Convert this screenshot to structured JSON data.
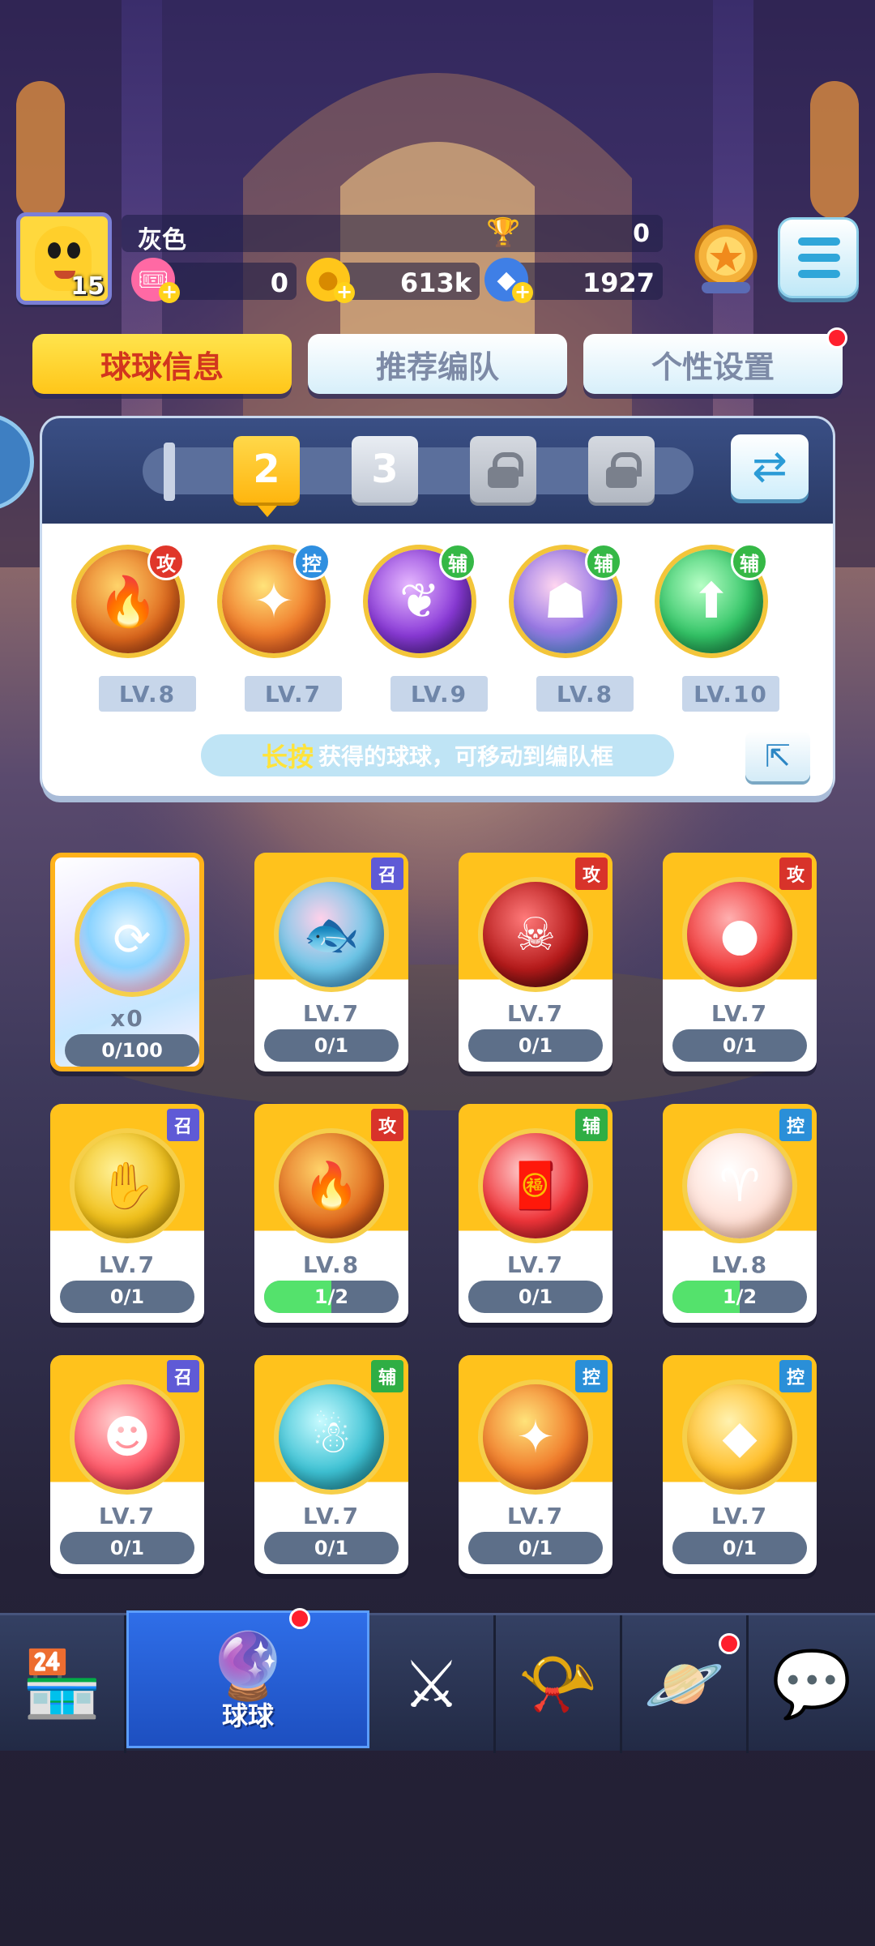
{
  "player": {
    "name": "灰色",
    "level": "15",
    "trophies": "0",
    "tickets": "0",
    "coins": "613k",
    "gems": "1927"
  },
  "tabs": [
    {
      "label": "球球信息",
      "active": true
    },
    {
      "label": "推荐编队",
      "active": false
    },
    {
      "label": "个性设置",
      "active": false,
      "badge": true
    }
  ],
  "team": {
    "slots": [
      "2",
      "3"
    ],
    "selected_slot": "2",
    "members": [
      {
        "role": "攻",
        "level": "LV.8"
      },
      {
        "role": "控",
        "level": "LV.7"
      },
      {
        "role": "辅",
        "level": "LV.9"
      },
      {
        "role": "辅",
        "level": "LV.8"
      },
      {
        "role": "辅",
        "level": "LV.10"
      }
    ],
    "hint_highlight": "长按",
    "hint_text": "获得的球球，可移动到编队框"
  },
  "balls": [
    {
      "special": true,
      "count": "x0",
      "progress": "0/100",
      "progress_value": 0
    },
    {
      "role": "召",
      "level": "LV.7",
      "progress": "0/1",
      "progress_value": 0
    },
    {
      "role": "攻",
      "level": "LV.7",
      "progress": "0/1",
      "progress_value": 0
    },
    {
      "role": "攻",
      "level": "LV.7",
      "progress": "0/1",
      "progress_value": 0
    },
    {
      "role": "召",
      "level": "LV.7",
      "progress": "0/1",
      "progress_value": 0
    },
    {
      "role": "攻",
      "level": "LV.8",
      "progress": "1/2",
      "progress_value": 0.5
    },
    {
      "role": "辅",
      "level": "LV.7",
      "progress": "0/1",
      "progress_value": 0
    },
    {
      "role": "控",
      "level": "LV.8",
      "progress": "1/2",
      "progress_value": 0.5
    },
    {
      "role": "召",
      "level": "LV.7",
      "progress": "0/1",
      "progress_value": 0
    },
    {
      "role": "辅",
      "level": "LV.7",
      "progress": "0/1",
      "progress_value": 0
    },
    {
      "role": "控",
      "level": "LV.7",
      "progress": "0/1",
      "progress_value": 0
    },
    {
      "role": "控",
      "level": "LV.7",
      "progress": "0/1",
      "progress_value": 0
    }
  ],
  "nav": {
    "active_label": "球球",
    "items": [
      "shop-icon",
      "ball-icon",
      "crossed-swords-icon",
      "whistle-icon",
      "planet-icon",
      "chat-heart-icon"
    ]
  },
  "colors": {
    "accent_yellow": "#ffc21c",
    "attack_red": "#d8332a",
    "control_blue": "#2a8fd8",
    "support_green": "#2fae44",
    "summon_purple": "#5f5ad6"
  }
}
